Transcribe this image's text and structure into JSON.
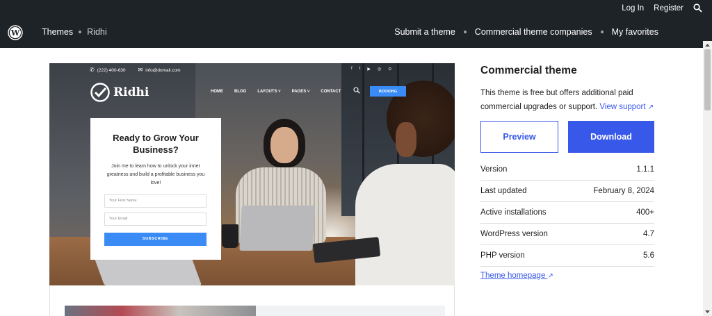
{
  "header": {
    "login": "Log In",
    "register": "Register",
    "breadcrumb": [
      "Themes",
      "Ridhi"
    ],
    "nav": [
      "Submit a theme",
      "Commercial theme companies",
      "My favorites"
    ]
  },
  "preview": {
    "phone": "(222) 400-630",
    "email": "info@domail.com",
    "social": [
      "f",
      "t",
      "▶",
      "◎",
      "⊙"
    ],
    "logo_text": "Ridhi",
    "nav": [
      "HOME",
      "BLOG",
      "LAYOUTS ˅",
      "PAGES ˅",
      "CONTACT"
    ],
    "booking": "BOOKING",
    "card_title": "Ready to Grow Your Business?",
    "card_text": "Join me to learn how to unlock your inner greatness and build a profitable business you love!",
    "first_name_placeholder": "Your First Name",
    "email_placeholder": "Your Email",
    "subscribe": "SUBSCRIBE"
  },
  "sidebar": {
    "title": "Commercial theme",
    "desc": "This theme is free but offers additional paid commercial upgrades or support.",
    "support_link": "View support",
    "preview_btn": "Preview",
    "download_btn": "Download",
    "meta": [
      {
        "label": "Version",
        "value": "1.1.1"
      },
      {
        "label": "Last updated",
        "value": "February 8, 2024"
      },
      {
        "label": "Active installations",
        "value": "400+"
      },
      {
        "label": "WordPress version",
        "value": "4.7"
      },
      {
        "label": "PHP version",
        "value": "5.6"
      }
    ],
    "homepage_link": "Theme homepage"
  }
}
